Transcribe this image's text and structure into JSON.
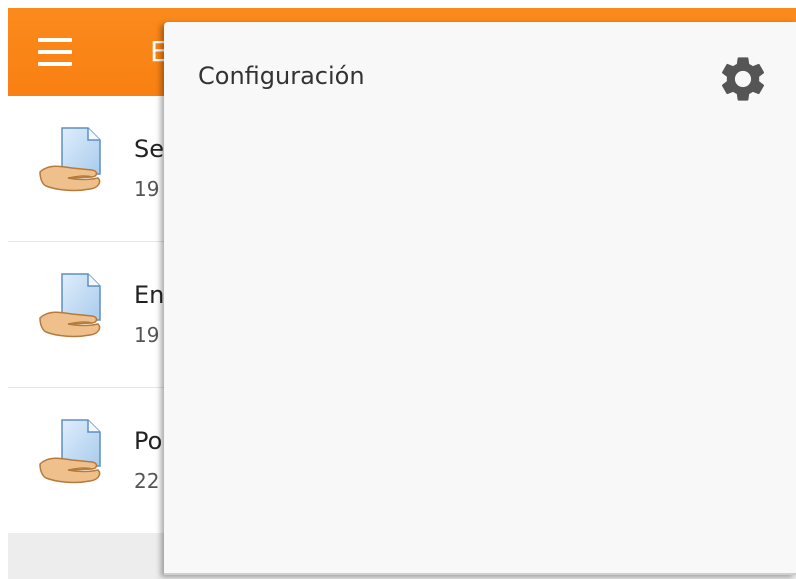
{
  "header": {
    "title_partial": "E",
    "menu_icon": "hamburger-menu-icon",
    "bar_color": "#f98012"
  },
  "list": {
    "items": [
      {
        "title_partial": "Se",
        "subtitle_partial": "19",
        "icon": "assignment-hand-document-icon"
      },
      {
        "title_partial": "En",
        "subtitle_partial": "19",
        "icon": "assignment-hand-document-icon"
      },
      {
        "title_partial": "Po",
        "subtitle_partial": "22",
        "icon": "assignment-hand-document-icon"
      }
    ]
  },
  "settings_panel": {
    "label": "Configuración",
    "icon": "gear-icon"
  }
}
